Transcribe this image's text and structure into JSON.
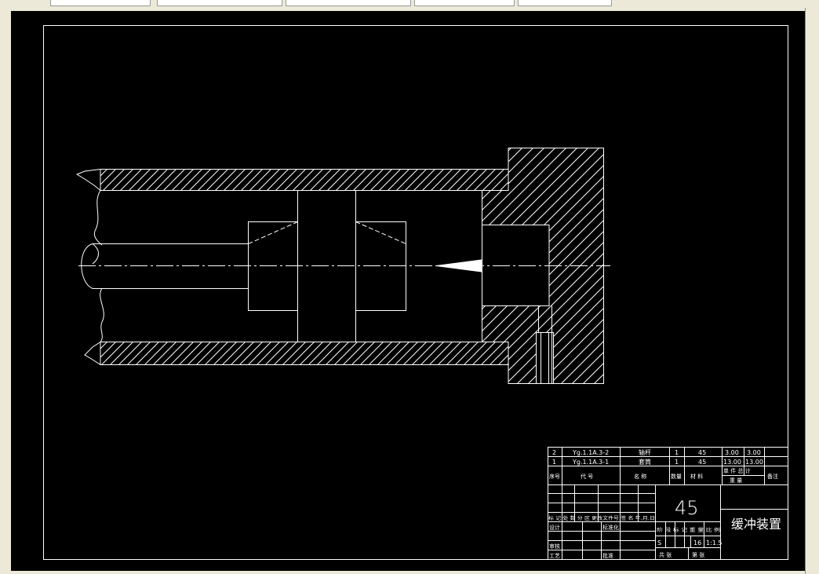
{
  "tabs": [
    {
      "label": ""
    },
    {
      "label": ""
    },
    {
      "label": ""
    },
    {
      "label": ""
    },
    {
      "label": ""
    }
  ],
  "title_block": {
    "bom_rows": [
      {
        "no": "2",
        "code": "Yg.1.1A.3-2",
        "name": "轴杆",
        "qty": "1",
        "material": "45",
        "unit_mass": "3.00",
        "total_mass": "3.00"
      },
      {
        "no": "1",
        "code": "Yg.1.1A.3-1",
        "name": "套筒",
        "qty": "1",
        "material": "45",
        "unit_mass": "13.00",
        "total_mass": "13.00"
      }
    ],
    "headers": {
      "no": "序号",
      "code": "代  号",
      "name": "名  称",
      "qty": "数量",
      "material": "材  料",
      "mass_label": "单 件 总 计",
      "mass_sub": "重  量",
      "remarks": "备注"
    },
    "material_big": "45",
    "drawing_name": "缓冲装置",
    "rev_header": "标 记 处 数  分  区  更改文件号 签 名 年.月.日",
    "design": "设计",
    "standardize": "标准化",
    "review": "审核",
    "process": "工艺",
    "approve": "批准",
    "stage_header": "阶 段 标 记   重 量  比 例",
    "stage_value": "S",
    "weight": "16",
    "scale": "1:1.5",
    "sheets_total": "共  张",
    "sheet_no": "第  张"
  }
}
